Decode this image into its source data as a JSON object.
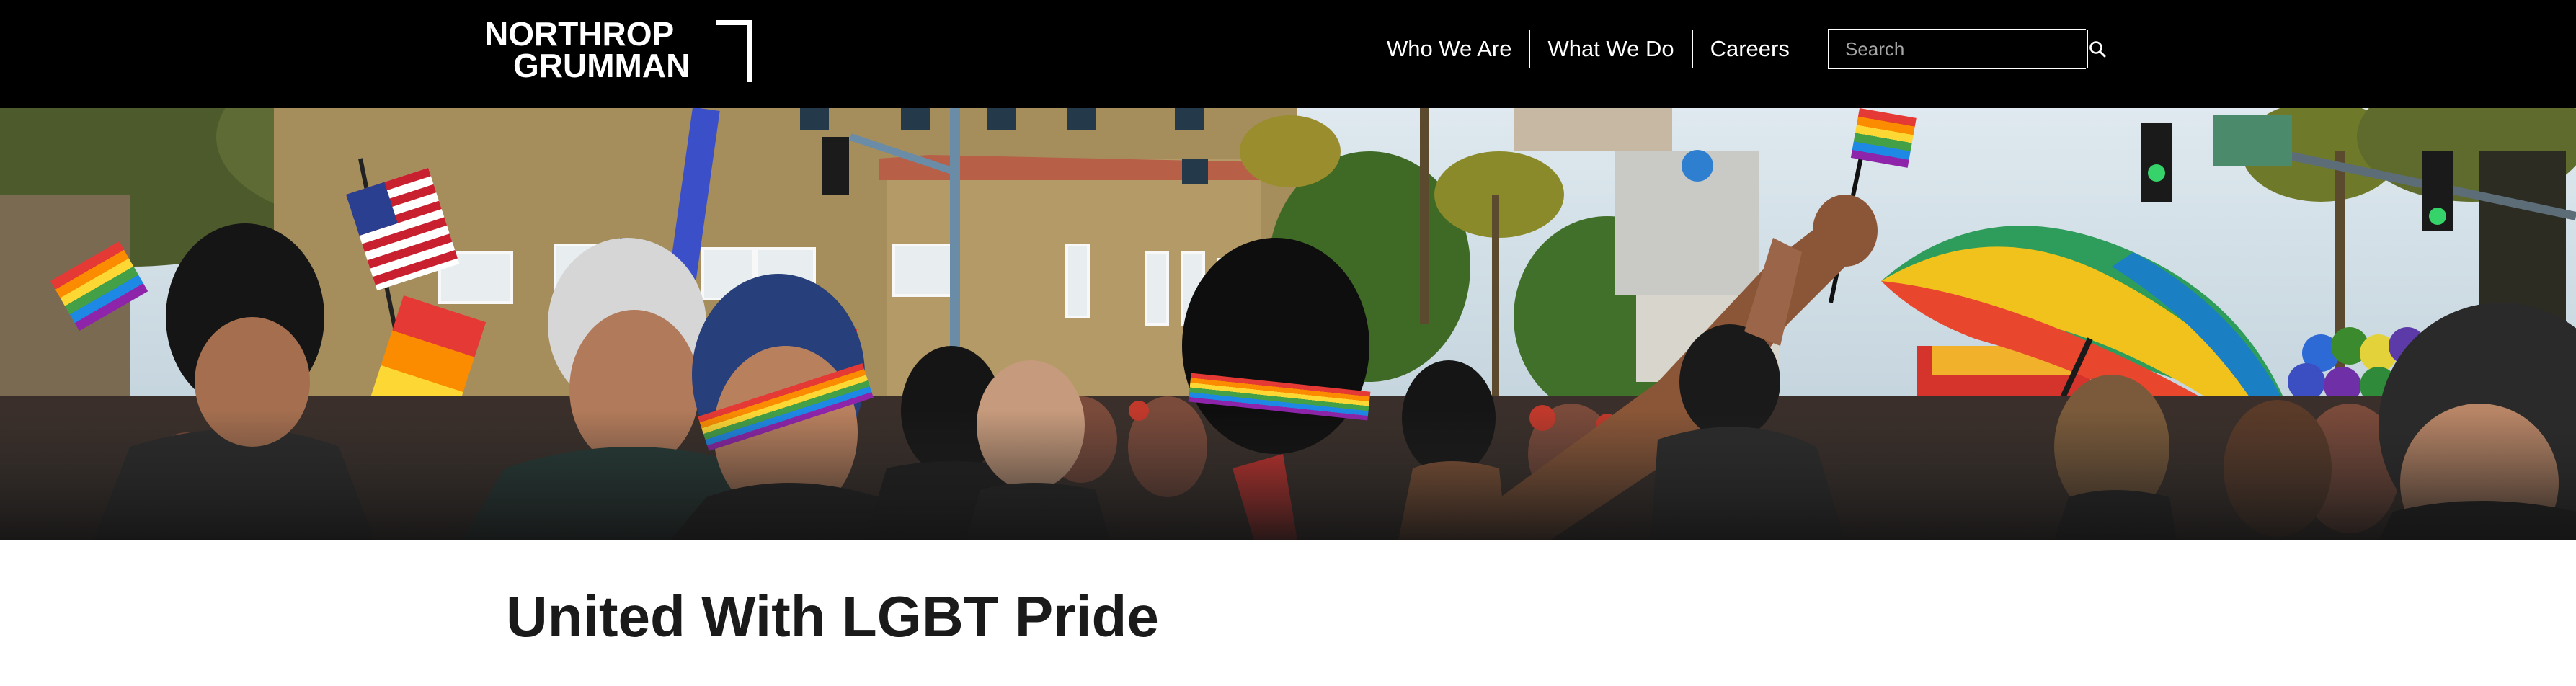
{
  "brand": {
    "logo_line1": "NORTHROP",
    "logo_line2": "GRUMMAN",
    "logo_alt": "Northrop Grumman"
  },
  "nav": {
    "items": [
      {
        "label": "Who We Are"
      },
      {
        "label": "What We Do"
      },
      {
        "label": "Careers"
      }
    ]
  },
  "search": {
    "placeholder": "Search",
    "value": "",
    "icon": "search-icon"
  },
  "hero": {
    "image": "pride-parade-crowd-photo"
  },
  "page": {
    "title": "United With LGBT Pride"
  },
  "colors": {
    "header_bg": "#000000",
    "header_text": "#ffffff",
    "title_text": "#1a1a1a",
    "page_bg": "#ffffff"
  }
}
